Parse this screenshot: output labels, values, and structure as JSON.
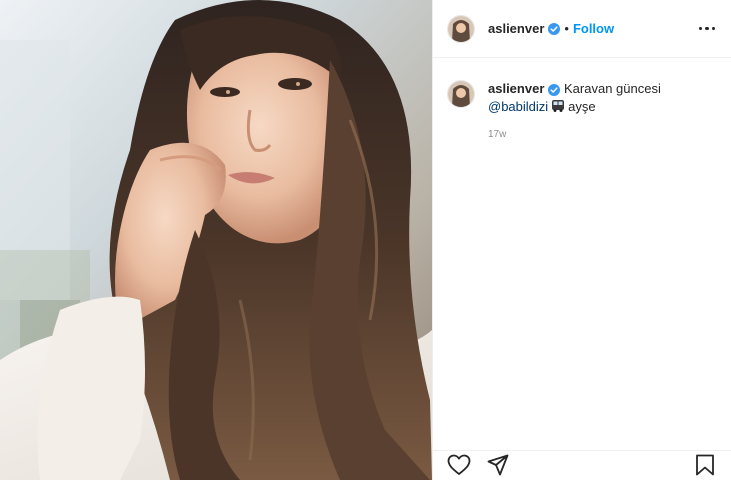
{
  "post": {
    "username": "aslienver",
    "separator": "•",
    "follow_label": "Follow",
    "caption": {
      "text_before": "Karavan güncesi",
      "mention": "@babildizi",
      "emoji_icon": "bus-emoji-icon",
      "text_after": "ayşe"
    },
    "time_ago": "17w"
  },
  "icons": {
    "verified": "verified-badge-icon",
    "more": "more-options-icon",
    "like": "heart-icon",
    "share": "paper-plane-icon",
    "save": "bookmark-icon"
  },
  "colors": {
    "accent": "#0095f6",
    "verified": "#3897f0",
    "mention": "#00376b",
    "text": "#262626",
    "muted": "#8e8e8e"
  }
}
